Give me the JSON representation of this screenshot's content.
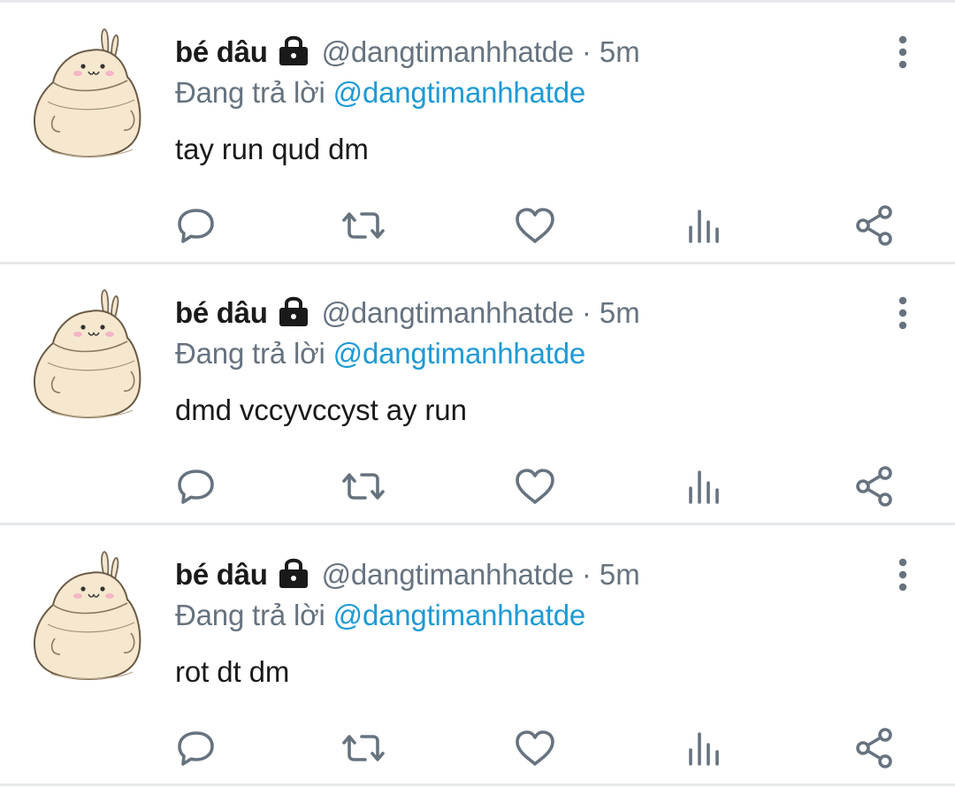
{
  "tweets": [
    {
      "display_name": "bé dâu",
      "handle": "@dangtimanhhatde",
      "separator": "·",
      "time": "5m",
      "reply_prefix": "Đang trả lời",
      "reply_target": "@dangtimanhhatde",
      "text": "tay run qud dm",
      "icons": [
        "avatar",
        "lock-icon",
        "more-icon",
        "reply-icon",
        "retweet-icon",
        "like-icon",
        "views-icon",
        "share-icon"
      ]
    },
    {
      "display_name": "bé dâu",
      "handle": "@dangtimanhhatde",
      "separator": "·",
      "time": "5m",
      "reply_prefix": "Đang trả lời",
      "reply_target": "@dangtimanhhatde",
      "text": "dmd vccyvccyst ay run",
      "icons": [
        "avatar",
        "lock-icon",
        "more-icon",
        "reply-icon",
        "retweet-icon",
        "like-icon",
        "views-icon",
        "share-icon"
      ]
    },
    {
      "display_name": "bé dâu",
      "handle": "@dangtimanhhatde",
      "separator": "·",
      "time": "5m",
      "reply_prefix": "Đang trả lời",
      "reply_target": "@dangtimanhhatde",
      "text": "rot dt dm",
      "icons": [
        "avatar",
        "lock-icon",
        "more-icon",
        "reply-icon",
        "retweet-icon",
        "like-icon",
        "views-icon",
        "share-icon"
      ]
    }
  ],
  "colors": {
    "text_primary": "#1a1a1a",
    "text_secondary": "#66737f",
    "link": "#1d9ad6",
    "divider": "#e6e9ec"
  }
}
